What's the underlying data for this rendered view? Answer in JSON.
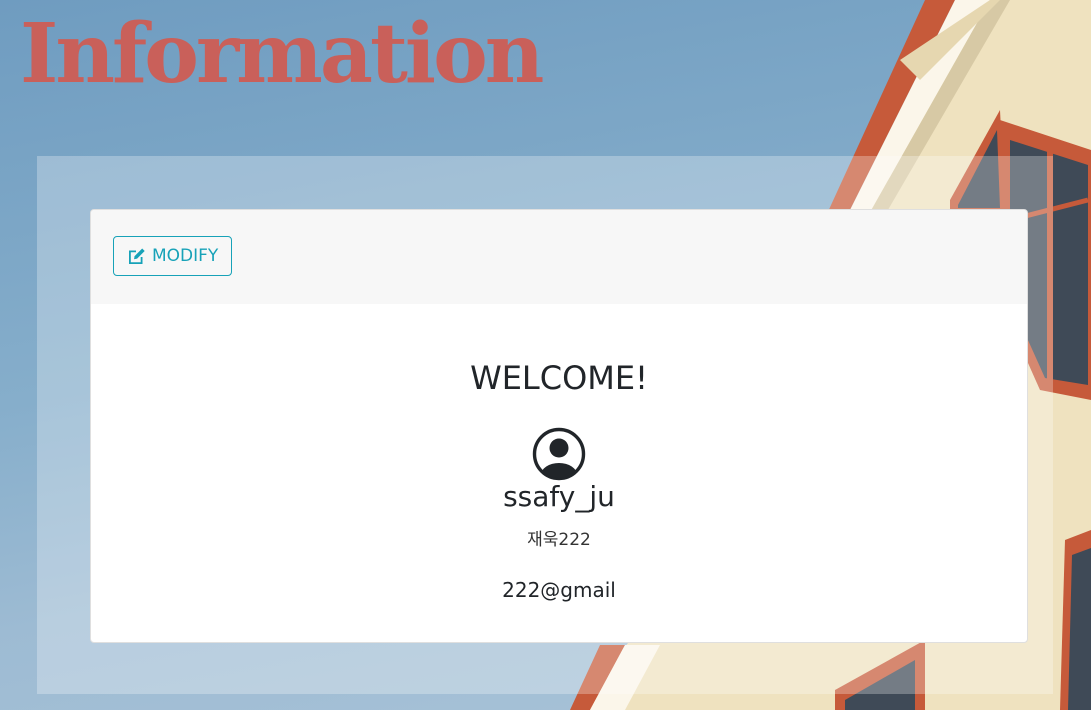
{
  "page": {
    "title": "Information"
  },
  "card": {
    "modify_label": "MODIFY",
    "welcome": "WELCOME!",
    "username": "ssafy_ju",
    "name": "재욱222",
    "email": "222@gmail"
  },
  "colors": {
    "title": "#c9605a",
    "accent": "#17a2b8",
    "text": "#212529"
  },
  "icons": {
    "modify": "edit-icon",
    "avatar": "person-circle-icon"
  }
}
